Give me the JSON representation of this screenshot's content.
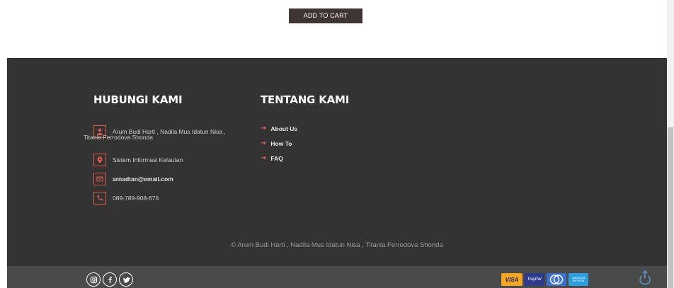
{
  "product": {
    "add_to_cart_label": "ADD TO CART"
  },
  "footer": {
    "contact_title": "HUBUNGI KAMI",
    "about_title": "TENTANG KAMI",
    "contact": {
      "authors": "Arum Budi Harti , Nadila Mus Idatun Nisa , Titania Ferrodova Shonda",
      "address": "Sistem Informasi Kelautan",
      "email": "arnadtan@email.com",
      "phone": "089-789-908-676"
    },
    "links": [
      {
        "label": "About Us"
      },
      {
        "label": "How To"
      },
      {
        "label": "FAQ"
      }
    ],
    "copyright": "© Arum Budi Harti , Nadila Mus Idatun Nisa , Titania Ferrodova Shonda"
  },
  "bottom_bar": {
    "social_icons": [
      "instagram-icon",
      "facebook-icon",
      "twitter-icon"
    ],
    "payments": [
      "VISA",
      "PayPal",
      "mastercard",
      "AMERICAN EXPRESS"
    ]
  },
  "colors": {
    "footer_bg": "#333333",
    "accent": "#e05a47",
    "bottom_bar_bg": "#4a4a4a",
    "button_bg": "#3e3431"
  }
}
